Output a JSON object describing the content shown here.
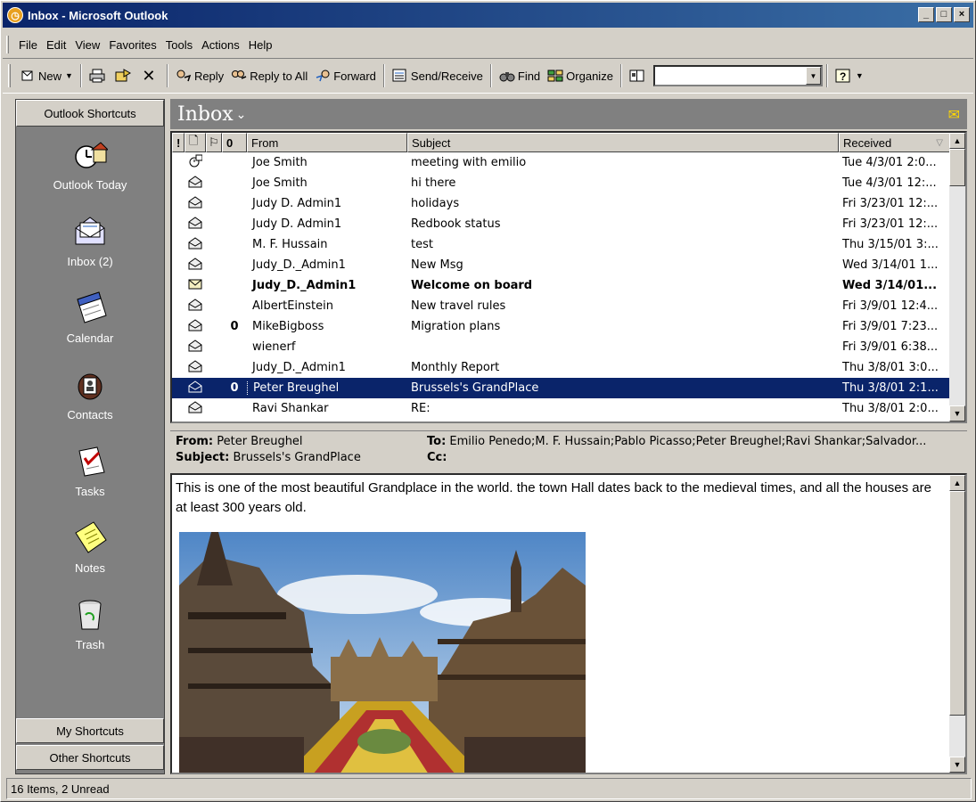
{
  "window": {
    "title": "Inbox - Microsoft Outlook"
  },
  "menubar": {
    "items": [
      "File",
      "Edit",
      "View",
      "Favorites",
      "Tools",
      "Actions",
      "Help"
    ]
  },
  "toolbar": {
    "new_label": "New",
    "reply_label": "Reply",
    "reply_all_label": "Reply to All",
    "forward_label": "Forward",
    "send_receive_label": "Send/Receive",
    "find_label": "Find",
    "organize_label": "Organize",
    "combo_value": ""
  },
  "outlookbar": {
    "header": "Outlook Shortcuts",
    "items": [
      {
        "label": "Outlook Today",
        "icon": "outlook-today-icon"
      },
      {
        "label": "Inbox (2)",
        "icon": "inbox-icon"
      },
      {
        "label": "Calendar",
        "icon": "calendar-icon"
      },
      {
        "label": "Contacts",
        "icon": "contacts-icon"
      },
      {
        "label": "Tasks",
        "icon": "tasks-icon"
      },
      {
        "label": "Notes",
        "icon": "notes-icon"
      },
      {
        "label": "Trash",
        "icon": "trash-icon"
      }
    ],
    "my_shortcuts": "My Shortcuts",
    "other_shortcuts": "Other Shortcuts"
  },
  "folder": {
    "title": "Inbox"
  },
  "columns": {
    "importance": "!",
    "icon": "",
    "flag": "",
    "attachment": "",
    "from": "From",
    "subject": "Subject",
    "received": "Received"
  },
  "messages": [
    {
      "from": "Joe Smith",
      "subject": "meeting with emilio",
      "received": "Tue 4/3/01 2:0...",
      "icon": "meeting-request-icon",
      "attach": false,
      "bold": false,
      "selected": false
    },
    {
      "from": "Joe Smith",
      "subject": "hi there",
      "received": "Tue 4/3/01 12:...",
      "icon": "read-envelope-icon",
      "attach": false,
      "bold": false,
      "selected": false
    },
    {
      "from": "Judy D. Admin1",
      "subject": "holidays",
      "received": "Fri 3/23/01 12:...",
      "icon": "read-envelope-icon",
      "attach": false,
      "bold": false,
      "selected": false
    },
    {
      "from": "Judy D. Admin1",
      "subject": "Redbook status",
      "received": "Fri 3/23/01 12:...",
      "icon": "read-envelope-icon",
      "attach": false,
      "bold": false,
      "selected": false
    },
    {
      "from": "M. F. Hussain",
      "subject": "test",
      "received": "Thu 3/15/01 3:...",
      "icon": "read-envelope-icon",
      "attach": false,
      "bold": false,
      "selected": false
    },
    {
      "from": "Judy_D._Admin1",
      "subject": "New Msg",
      "received": "Wed 3/14/01 1...",
      "icon": "read-envelope-icon",
      "attach": false,
      "bold": false,
      "selected": false
    },
    {
      "from": "Judy_D._Admin1",
      "subject": "Welcome on board",
      "received": "Wed 3/14/01...",
      "icon": "unread-envelope-icon",
      "attach": false,
      "bold": true,
      "selected": false
    },
    {
      "from": "AlbertEinstein",
      "subject": "New travel rules",
      "received": "Fri 3/9/01 12:4...",
      "icon": "read-envelope-icon",
      "attach": false,
      "bold": false,
      "selected": false
    },
    {
      "from": "MikeBigboss",
      "subject": "Migration plans",
      "received": "Fri 3/9/01 7:23...",
      "icon": "read-envelope-icon",
      "attach": true,
      "bold": false,
      "selected": false
    },
    {
      "from": "wienerf",
      "subject": "",
      "received": "Fri 3/9/01 6:38...",
      "icon": "read-envelope-icon",
      "attach": false,
      "bold": false,
      "selected": false
    },
    {
      "from": "Judy_D._Admin1",
      "subject": "Monthly Report",
      "received": "Thu 3/8/01 3:0...",
      "icon": "read-envelope-icon",
      "attach": false,
      "bold": false,
      "selected": false
    },
    {
      "from": "Peter Breughel",
      "subject": "Brussels's GrandPlace",
      "received": "Thu 3/8/01 2:1...",
      "icon": "read-envelope-icon",
      "attach": true,
      "bold": false,
      "selected": true
    },
    {
      "from": "Ravi Shankar",
      "subject": "RE:",
      "received": "Thu 3/8/01 2:0...",
      "icon": "read-envelope-icon",
      "attach": false,
      "bold": false,
      "selected": false
    }
  ],
  "preview": {
    "from_label": "From:",
    "from_value": "Peter Breughel",
    "subject_label": "Subject:",
    "subject_value": "Brussels's GrandPlace",
    "to_label": "To:",
    "to_value": "Emilio Penedo;M. F. Hussain;Pablo Picasso;Peter Breughel;Ravi Shankar;Salvador...",
    "cc_label": "Cc:",
    "cc_value": "",
    "body": "This is one of the most beautiful Grandplace in the world.  the town Hall dates back to the medieval times, and all the houses are at least 300 years old."
  },
  "status": {
    "text": "16 Items, 2 Unread"
  },
  "colors": {
    "title_start": "#0a246a",
    "title_end": "#3a6ea5",
    "selection": "#0a246a",
    "panel_gray": "#808080",
    "face": "#d4d0c8"
  }
}
